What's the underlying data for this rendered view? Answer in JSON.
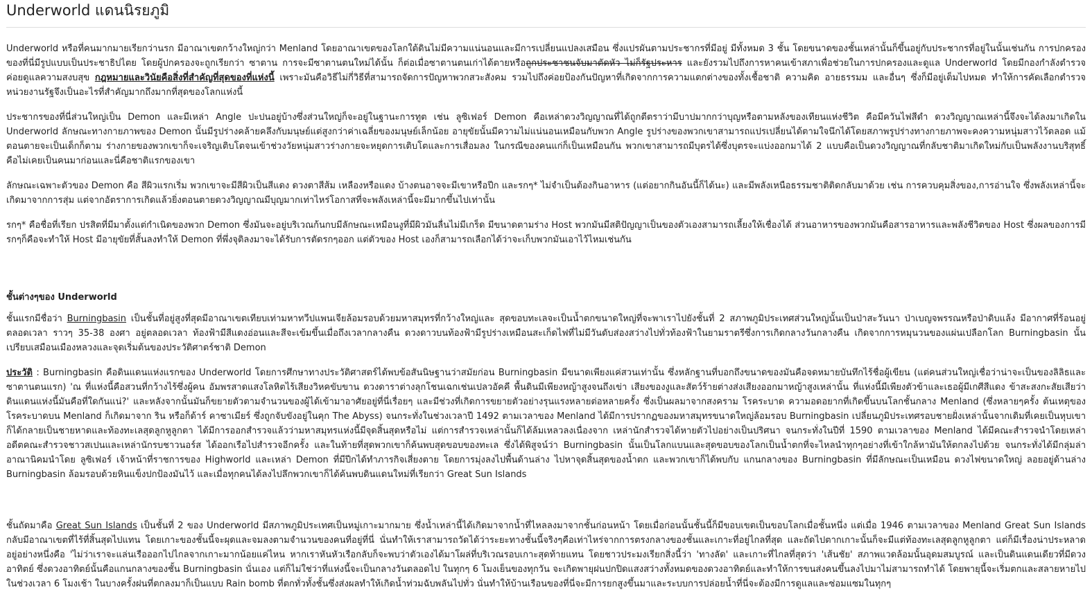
{
  "page": {
    "title": "Underworld แดนนิรยภูมิ"
  },
  "intro": {
    "p1_a": "Underworld หรือที่คนมากมายเรียกว่านรก มีอาณาเขตกว้างใหญ่กว่า Menland โดยอาณาเขตของโลกใต้ดินไม่มีความแน่นอนและมีการเปลี่ยนแปลงเสมือน ซึ่งแปรผันตามประชากรที่มีอยู่ มีทั้งหมด 3 ชั้น โดยขนาดของชั้นเหล่านั้นก็ขึ้นอยู่กับประชากรที่อยู่ในนั้นเช่นกัน การปกครองของที่นี่มีรูปแบบเป็นประชาธิปไตย โดยผู้ปกครองจะถูกเรียกว่า ซาตาน การจะมีซาตานตนใหม่ได้นั้น ก็ต่อเมื่อซาตานตนเก่าได้ตายหรือ",
    "p1_strike": "ถูกประชาชนจับมาตัดหัว ไม่ก็รัฐประหาร",
    "p1_b": " และยังรวมไปถึงการหาคนเข้าสภาเพื่อช่วยในการปกครองและดูแล Underworld โดยมีกองกำลังตำรวจค่อยดูแลความสงบสุข ",
    "p1_bold": "กฎหมายและวินัยคือสิ่งที่สำคัญที่สุดของที่แห่งนี้",
    "p1_c": " เพราะมันคือวิธีไม่กี่วิธีที่สามารถจัดการปัญหาพวกสวะสังคม รวมไปถึงค่อยป้องกันปัญหาที่เกิดจากการความแตกต่างของทั้งเชื้อชาติ ความคิด อายธรรมม และอื่นๆ ซึ่งก็มีอยู่เต็มไปหมด ทำให้การคัดเลือกตำรวจ หน่วยงานรัฐจึงเป็นอะไรที่สำคัญมากถึงมากที่สุดของโลกแห่งนี้",
    "p2": "ประชากรของที่นี่ส่วนใหญ่เป็น Demon และมีเหล่า Angle ปะปนอยู่บ้างซึ่งส่วนใหญ่ก็จะอยู่ในฐานะการทูต เช่น ลูซิเฟอร์ Demon คือเหล่าดวงวิญญาณที่ได้ถูกตีตราว่ามีบาปมากกว่าบุญหรือตามหลังของเทียนแห่งชีวิต คือมีควันไฟสีดำ ดวงวิญญาณเหล่านี้จึงจะได้ลงมาเกิดใน Underworld ลักษณะทางกายภาพของ Demon นั้นมีรูปร่างคล้ายคลึงกับมนุษย์แต่สูงกว่าค่าเฉลี่ยของมนุษย์เล็กน้อย อายุขัยนั้นมีความไม่แน่นอนเหมือนกับพวก Angle รูปร่างของพวกเขาสามารถแปรเปลี่ยนได้ตามใจนึกได้โดยสภาพรูปร่างทางกายภาพจะคงความหนุ่มสาวไว้ตลอด แม้ตอนตายจะเป็นเด็กก็ตาม ร่างกายของพวกเขาก็จะเจริญเติบโตจนเข้าช่วงวัยหนุ่มสาวร่างกายจะหยุดการเติบโตและการเสื่อมลง ในกรณีของคนแก่ก็เป็นเหมือนกัน พวกเขาสามารถมีบุตรได้ซึ่งบุตรจะแบ่งออกมาได้ 2 แบบคือเป็นดวงวิญญาณที่กลับชาติมาเกิดใหม่กับเป็นพลังงานบริสุทธิ์ คือไม่เคยเป็นคนมาก่อนและนี่คือชาติแรกของเขา",
    "p3": "ลักษณะเฉพาะตัวของ Demon คือ สีผิวแรกเริ่ม พวกเขาจะมีสีผิวเป็นสีแดง ดวงตาสีส้ม เหลืองหรือแดง บ้างตนอาจจะมีเขาหรือปีก และรกๆ* ไม่จำเป็นต้องกินอาหาร (แต่อยากกินอันนี้ก็ได้นะ) และมีพลังเหนือธรรมชาติติดกลับมาด้วย เช่น การควบคุมสิ่งของ,การอ่านใจ ซึ่งพลังเหล่านี้จะเกิดมาจากการสุ่ม แต่จากอัตราการเกิดแล้วยิ่งตอนตายดวงวิญญาณมีบุญมากเท่าไหร่โอกาสที่จะพลังเหล่านี้จะมีมากขึ้นไปเท่านั้น",
    "p4": "รกๆ* คือชื่อที่เรียก ปรสิตที่มีมาตั้งแต่กำเนิดของพวก Demon ซึ่งมันจะอยู่บริเวณก้นกบมีลักษณะเหมือนงูที่มีผิวมันลื่นไม่มีเกร็ด มีขนาดตามร่าง Host พวกมันมีสติปัญญาเป็นของตัวเองสามารถเลี้ยงให้เชื่องได้ ส่วนอาหารของพวกมันคือสารอาหารและพลังชีวิตของ Host ซึ่งผลของการมีรกๆก็คือจะทำให้ Host มีอายุขัยที่สั้นลงทำให้ Demon ที่พึ่งจุติลงมาจะได้รับการตัดรกๆออก แต่ตัวของ Host เองก็สามารถเลือกได้ว่าจะเก็บพวกมันเอาไว้ไหมเช่นกัน"
  },
  "layers": {
    "heading": "ชั้นต่างๆของ Underworld",
    "l1_a": "ชั้นแรกมีชื่อว่า ",
    "l1_link": "Burningbasin",
    "l1_b": " เป็นชั้นที่อยู่สูงที่สุดมีอาณาเขตเทียบเท่ามหาทวีปแพนเจียล้อมรอบด้วยมหาสมุทรที่กว้างใหญ่และ สุดขอบทะเลจะเป็นน้ำตกขนาดใหญ่ที่จะพาเราไปยังชั้นที่ 2 สภาพภูมิประเทศส่วนใหญ่นั้นเป็นป่าสะวันนา ป่าเบญจพรรณหรือป่าดิบแล้ง มีอากาศที่ร้อนอยู่ตลอดเวลา ราวๆ 35-38 องศา อยู่ตลอดเวลา ท้องฟ้ามีสีแดงอ่อนและสีจะเข้มขึ้นเมื่อถึงเวลากลางคืน ดวงดาวบนท้องฟ้ามีรูปร่างเหมือนสะเก็ดไฟที่ไม่มีวันดับส่องสว่างไปทั่วท้องฟ้าในยามราตรีซึ่งการเกิดกลางวันกลางคืน เกิดจากการหมุนวนของแผ่นเปลือกโลก Burningbasin นั้นเปรียบเสมือนเมืองหลวงและจุดเริ่มต้นของประวัติศาตร์ชาติ Demon",
    "history_label": "ประวัติ",
    "history_text": " : Burningbasin คือดินแดนแห่งแรกของ Underworld โดยการศึกษาทางประวัติศาสตร์ได้พบข้อสันนิษฐานว่าสมัยก่อน Burningbasin มีขนาดเพียงแค่สวนเท่านั้น ซึ่งหลักฐานที่บอกถึงขนาดของมันคือจดหมายบันทึกไร้ชื่อผู้เขียน (แต่คนส่วนใหญ่เชื่อว่าน่าจะเป็นของลิลิธและซาตานตนแรก) 'ณ ที่แห่งนี้คือสวนที่กว้างไร้ซึ่งผู้คน อัมพรสาดแสงโลหิตไร้เสียงวิหคขับขาน ดวงดาราต่างลุกโชนเฉกเช่นเปลวอัคคี พื้นดินมีเพียงหญ้าสูงจนถึงเข่า เสียงของงูและสัตว์ร้ายต่างส่งเสียงออกมาหญ้าสูงเหล่านั้น ที่แห่งนี้มีเพียงตัวข้าและเธอผู้มีเกศีสีแดง ข้าสะสงกะสัยเสียว่าดินแดนแห่งนี้มันคือที่ใดกันแน่?' และหลังจากนั้นมันก็ขยายตัวตามจำนวนของผู้ได้เข้ามาอาศัยอยู่ที่นี่เรื่อยๆ และมีช่วงที่เกิดการขยายตัวอย่างรุนแรงหลายต่อหลายครั้ง ซึ่งเป็นผลมาจากสงคราม โรคระบาด ความอดอยากที่เกิดขึ้นบนโลกชั้นกลาง Menland (ซึ่งหลายๆครั้ง ต้นเหตุของโรคระบาดบน Menland ก็เกิดมาจาก ริน หรือก็ด้าร์ คาซาเมียร์ ซึ่งถูกจับขังอยู่ในคุก The Abyss) จนกระทั่งในช่วงเวลาปี 1492 ตามเวลาของ Menland ได้มีการปรากฏของมหาสมุทรขนาดใหญ่ล้อมรอบ  Burningbasin เปลี่ยนภูมิประเทศรอบชายฝั่งเหล่านั้นจากเดิมที่เคยเป็นหุบเขาก็ได้กลายเป็นชายหาดและท้องทะเลสุดลูกหูลูกตา ได้มีการออกสำรวจแล้วว่ามหาสมุทรแห่งนี้มีจุดสิ้นสุดหรือไม่ แต่การสำรวจเหล่านั้นก็ได้ล้มเหลวลงเนื่องจาก เหล่านักสำรวจได้หายตัวไปอย่างเป็นปริศนา จนกระทั่งในปีที่ 1590 ตามเวลาของ Menland ได้มีคณะสำรวจนำโดยเหล่าอดีตคณะสำรวจชาวสเปนและเหล่านักรบชาวนอร์ส ได้ออกเรือไปสำรวจอีกครั้ง และในท้ายที่สุดพวกเขาก็ค้นพบสุดขอบของทะเล ซึ่งได้พิสูจน์ว่า Burningbasin นั้นเป็นโลกแบนและสุดขอบของโลกเป็นน้ำตกที่จะไหลนำทุกๆอย่างที่เข้าใกล้หามันให้ตกลงไปด้วย จนกระทั่งได้มีกลุ่มล่าอาณานิคมนำโดย ลูซิเฟอร์ เจ้าหน้าที่ราชการของ Highworld และเหล่า Demon ที่มีปีกได้ทำภารกิจเสี่ยงตาย โดยการมุ่งลงไปพื้นด้านล่าง ไปหาจุดสิ้นสุดของน้ำตก และพวกเขาก็ได้พบกับ แกนกลางของ Burningbasin ที่มีลักษณะเป็นเหมือน ดวงไฟขนาดใหญ่ ลอยอยู่ด้านล่าง Burningbasin ล้อมรอบด้วยหินแข็งปกป้องมันไว้ และเมื่อทุกคนได้ลงไปลึกพวกเขาก็ได้ค้นพบดินแดนใหม่ที่เรียกว่า Great Sun Islands",
    "l2_a": "ชั้นถัดมาคือ ",
    "l2_link": "Great Sun Islands",
    "l2_b": " เป็นชั้นที่ 2 ของ Underworld มีสภาพภูมิประเทศเป็นหมู่เกาะมากมาย ซึ่งน้ำเหล่านี้ได้เกิดมาจากน้ำที่ไหลลงมาจากชั้นก่อนหน้า โดยเมื่อก่อนนั้นชั้นนี้ก็มีขอบเขตเป็นขอบโลกเมื่อชั้นหนึ่ง แต่เมื่อ 1946 ตามเวลาของ Menland Great Sun Islands กลับมีอาณาเขตที่ไร้ที่สิ้นสุดไปแทน โดยเกาะของชั้นนี้จะผุดและจมลงตามจำนวนของคนที่อยู่ที่นี่ นั่นทำให้เราสามารถวัดได้ว่าระยะทางชั้นนี้จริงๆคือเท่าไหร่จากการตรงกลางของชั้นและเกาะที่อยู่ไกลที่สุด และถัดไปตากเกาะนั้นก็จะมีแต่ท้องทะเลสุดลูกหูลูกตา  แต่ก็มีเรื่องน่าประหลาดอยู่อย่างหนึ่งคือ 'ไม่ว่าเราจะแล่นเรือออกไปไกลจากเกาะมากน้อยแค่ไหน หากเราหันหัวเรือกลับก็จะพบว่าตัวเองได้มาโผล่ที่บริเวณรอบเกาะสุดท้ายแทน โดยชาวประมงเรียกสิ่งนี้ว่า 'ทางลัด' และเกาะที่ไกลที่สุดว่า 'เส้นชัย' สภาพแวดล้อมนั้นอุดมสมบูรณ์ และเป็นดินแดนเดียวที่มีดวงอาทิตย์ ซึ่งดวงอาทิตย์นั้นคือแกนกลางของชั้น Burningbasin นั่นเอง แต่ก็ไม่ใช่ว่าที่แห่งนี้จะเป็นกลางวันตลอดไป ในทุกๆ 6 โมงเย็นของทุกวัน จะเกิดพายุฝนปกปิดแสงสว่างทั้งหมดของดวงอาทิตย์และทำให้การขนส่งคนขึ้นลงไปมาไม่สามารถทำได้ โดยพายุนี้จะเริ่มตกและสลายหายไปในช่วงเวลา 6 โมงเช้า ในบางครั้งฝนที่ตกลงมาก็เป็นแบบ Rain bomb ที่ตกทั่วทั้งชั้นซึ่งส่งผลทำให้เกิดน้ำท่วมฉับพลันไปทั่ว นั่นทำให้บ้านเรือนของที่นี่จะมีการยกสูงขึ้นมาและระบบการปล่อยน้ำที่นี่จะต้องมีการดูแลและซ่อมแซมในทุกๆ"
  }
}
